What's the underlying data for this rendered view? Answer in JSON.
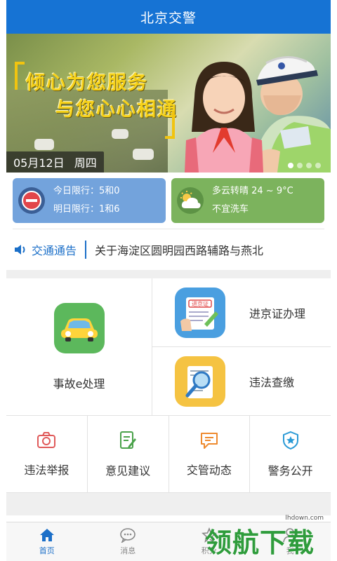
{
  "header": {
    "title": "北京交警"
  },
  "banner": {
    "slogan_line1": "倾心为您服务",
    "slogan_line2": "与您心心相通",
    "date": "05月12日",
    "weekday": "周四",
    "active_dot": 0,
    "dot_count": 4
  },
  "traffic_limit": {
    "today": "今日限行：5和0",
    "tomorrow": "明日限行：1和6",
    "icon": "no-entry-icon",
    "color": "#73a3dc"
  },
  "weather": {
    "condition": "多云转晴 24 ~ 9°C",
    "advice": "不宜洗车",
    "icon": "partly-cloudy-icon",
    "color": "#7cb35d"
  },
  "notice": {
    "label": "交通通告",
    "text": "关于海淀区圆明园西路辅路与燕北"
  },
  "services": {
    "accident": "事故e处理",
    "beijing_permit": "进京证办理",
    "violation_payment": "违法查缴",
    "permit_badge": "进京证"
  },
  "quick": [
    {
      "label": "违法举报",
      "icon": "camera-icon"
    },
    {
      "label": "意见建议",
      "icon": "edit-note-icon"
    },
    {
      "label": "交管动态",
      "icon": "message-icon"
    },
    {
      "label": "警务公开",
      "icon": "police-badge-icon"
    }
  ],
  "tabs": [
    {
      "label": "首页",
      "icon": "home-icon"
    },
    {
      "label": "消息",
      "icon": "chat-icon"
    },
    {
      "label": "积分",
      "icon": "points-icon"
    },
    {
      "label": "我",
      "icon": "user-icon"
    }
  ],
  "watermark": {
    "text": "领航下载",
    "url": "lhdown.com"
  },
  "colors": {
    "primary": "#1673d4",
    "accent": "#1b6fc8"
  }
}
